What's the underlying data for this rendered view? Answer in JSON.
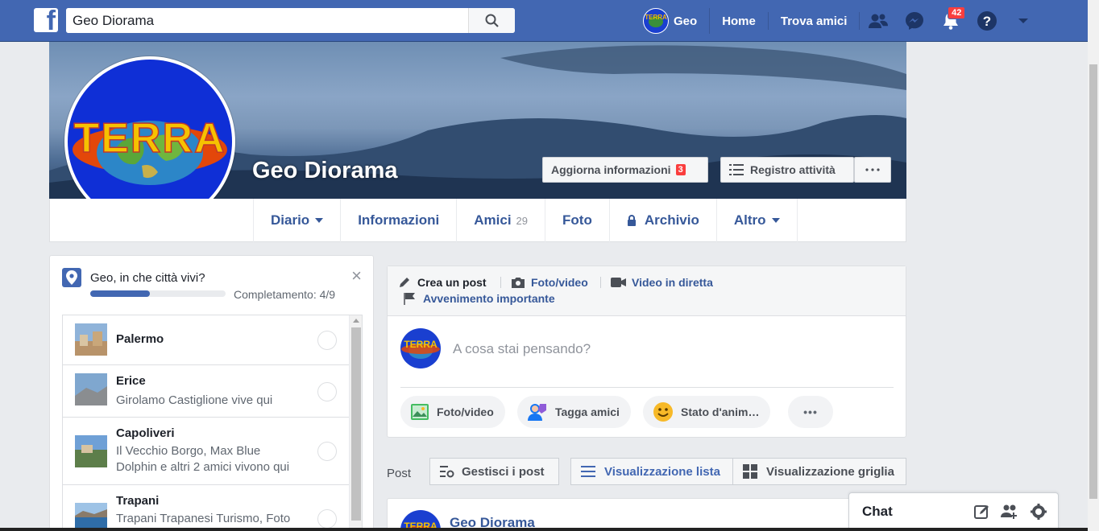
{
  "topbar": {
    "search_value": "Geo Diorama",
    "user_name": "Geo",
    "home_label": "Home",
    "find_friends_label": "Trova amici",
    "notifications_count": "42",
    "brand_color": "#4267b2"
  },
  "profile": {
    "name": "Geo Diorama",
    "avatar_text": "TERRA",
    "update_info_label": "Aggiorna informazioni",
    "update_info_count": "3",
    "activity_log_label": "Registro attività"
  },
  "tabs": [
    {
      "label": "Diario"
    },
    {
      "label": "Informazioni"
    },
    {
      "label": "Amici",
      "count": "29"
    },
    {
      "label": "Foto"
    },
    {
      "label": "Archivio"
    },
    {
      "label": "Altro"
    }
  ],
  "city_prompt": {
    "question": "Geo, in che città vivi?",
    "completion_label": "Completamento: 4/9",
    "completion_fraction": 0.44,
    "close": "×",
    "cities": [
      {
        "name": "Palermo",
        "subtitle": ""
      },
      {
        "name": "Erice",
        "subtitle": "Girolamo Castiglione vive qui"
      },
      {
        "name": "Capoliveri",
        "subtitle": "Il Vecchio Borgo, Max Blue Dolphin e altri 2 amici vivono qui"
      },
      {
        "name": "Trapani",
        "subtitle": "Trapani Trapanesi Turismo, Foto"
      }
    ]
  },
  "composer": {
    "create_post": "Crea un post",
    "photo_video": "Foto/video",
    "live_video": "Video in diretta",
    "life_event": "Avvenimento importante",
    "placeholder": "A cosa stai pensando?",
    "pill_photo": "Foto/video",
    "pill_tag": "Tagga amici",
    "pill_feeling": "Stato d'anim…",
    "more": "•••"
  },
  "posts_bar": {
    "label": "Post",
    "manage": "Gestisci i post",
    "list_view": "Visualizzazione lista",
    "grid_view": "Visualizzazione griglia"
  },
  "post": {
    "author": "Geo Diorama"
  },
  "chat": {
    "label": "Chat"
  }
}
